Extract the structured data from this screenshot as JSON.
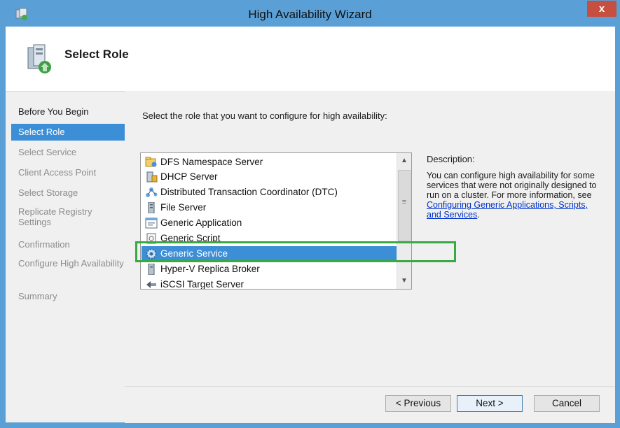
{
  "window": {
    "title": "High Availability Wizard",
    "close_label": "x"
  },
  "header": {
    "title": "Select Role"
  },
  "steps": [
    {
      "label": "Before You Begin"
    },
    {
      "label": "Select Role"
    },
    {
      "label": "Select Service"
    },
    {
      "label": "Client Access Point"
    },
    {
      "label": "Select Storage"
    },
    {
      "label": "Replicate Registry Settings"
    },
    {
      "label": "Confirmation"
    },
    {
      "label": "Configure High Availability"
    },
    {
      "label": "Summary"
    }
  ],
  "main": {
    "instruction": "Select the role that you want to configure for high availability:",
    "roles": [
      {
        "label": "DFS Namespace Server",
        "icon": "dfs-namespace-icon"
      },
      {
        "label": "DHCP Server",
        "icon": "dhcp-server-icon"
      },
      {
        "label": "Distributed Transaction Coordinator (DTC)",
        "icon": "dtc-icon"
      },
      {
        "label": "File Server",
        "icon": "file-server-icon"
      },
      {
        "label": "Generic Application",
        "icon": "generic-application-icon"
      },
      {
        "label": "Generic Script",
        "icon": "generic-script-icon"
      },
      {
        "label": "Generic Service",
        "icon": "generic-service-icon",
        "selected": true
      },
      {
        "label": "Hyper-V Replica Broker",
        "icon": "hyperv-replica-broker-icon"
      },
      {
        "label": "iSCSI Target Server",
        "icon": "iscsi-target-icon"
      }
    ],
    "description_label": "Description:",
    "description_text": "You can configure high availability for some services that were not originally designed to run on a cluster. For more information, see ",
    "description_link": "Configuring Generic Applications, Scripts, and Services",
    "description_end": "."
  },
  "buttons": {
    "previous": "< Previous",
    "next": "Next >",
    "cancel": "Cancel"
  },
  "colors": {
    "titlebar": "#5aa0d6",
    "selection": "#3c8ed6",
    "highlight_box": "#3aa843",
    "close": "#c74f40"
  }
}
